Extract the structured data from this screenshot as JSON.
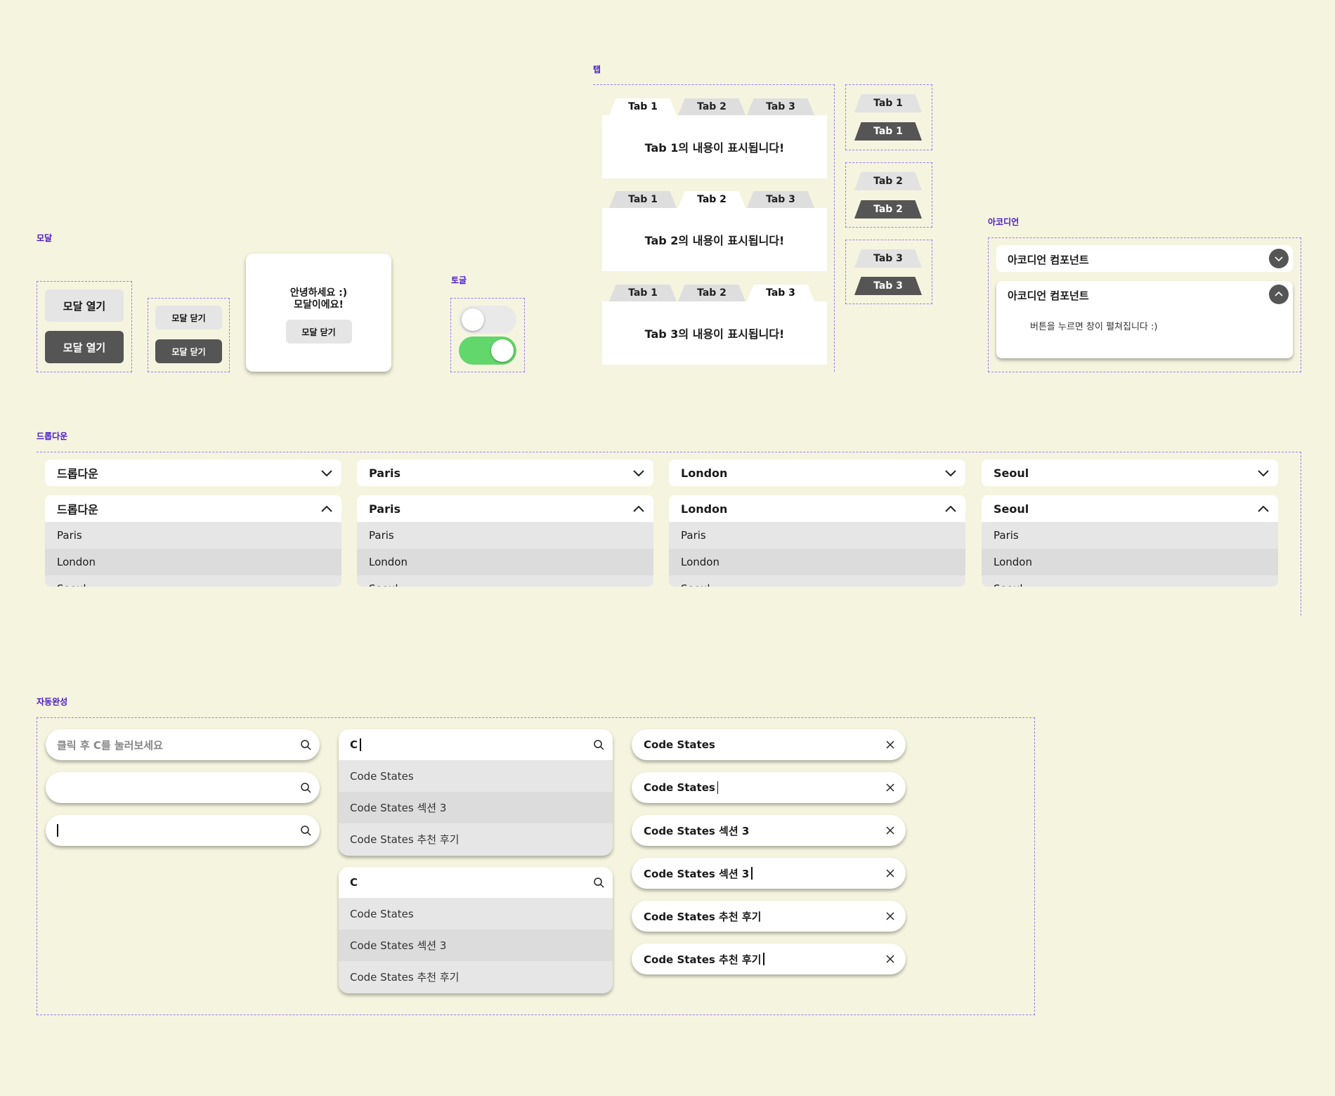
{
  "colors": {
    "background": "#f5f4df",
    "section_label": "#4a19c9",
    "dashed_border": "#9b7ef0",
    "dark_button": "#555555",
    "toggle_off": "#e9e9e9",
    "toggle_on": "#62d76b"
  },
  "sections": {
    "modal": "모달",
    "toggle": "토글",
    "tab": "탭",
    "accordion": "아코디언",
    "dropdown": "드롭다운",
    "autocomplete": "자동완성"
  },
  "modal": {
    "open_button_light": "모달 열기",
    "open_button_dark": "모달 열기",
    "close_button_light": "모달 닫기",
    "close_button_dark": "모달 닫기",
    "card_message": "안녕하세요 :)\n모달이에요!",
    "card_close_button": "모달 닫기"
  },
  "toggle": {
    "states": [
      "off",
      "on"
    ]
  },
  "tabs": {
    "labels": [
      "Tab 1",
      "Tab 2",
      "Tab 3"
    ],
    "panels": [
      {
        "active": 1,
        "content": "Tab 1의 내용이 표시됩니다!"
      },
      {
        "active": 2,
        "content": "Tab 2의 내용이 표시됩니다!"
      },
      {
        "active": 3,
        "content": "Tab 3의 내용이 표시됩니다!"
      }
    ],
    "state_pairs": [
      {
        "off": "Tab 1",
        "on": "Tab 1"
      },
      {
        "off": "Tab 2",
        "on": "Tab 2"
      },
      {
        "off": "Tab 3",
        "on": "Tab 3"
      }
    ]
  },
  "accordion": {
    "closed_title": "아코디언 컴포넌트",
    "open_title": "아코디언 컴포넌트",
    "open_body": "버튼을 누르면 창이 펼쳐집니다 :)"
  },
  "dropdown": {
    "selected": [
      "드롭다운",
      "Paris",
      "London",
      "Seoul"
    ],
    "options": [
      "Paris",
      "London",
      "Seoul"
    ]
  },
  "autocomplete": {
    "placeholder": "클릭 후 C를 눌러보세요",
    "typed": "C",
    "suggestions": [
      "Code States",
      "Code States 섹션 3",
      "Code States 추천 후기"
    ],
    "chips": [
      "Code States",
      "Code States",
      "Code States 섹션 3",
      "Code States 섹션 3",
      "Code States 추천 후기",
      "Code States 추천 후기"
    ]
  },
  "icons": {
    "search": "search-icon",
    "clear": "close-icon",
    "chevron_down": "chevron-down-icon",
    "chevron_up": "chevron-up-icon"
  }
}
